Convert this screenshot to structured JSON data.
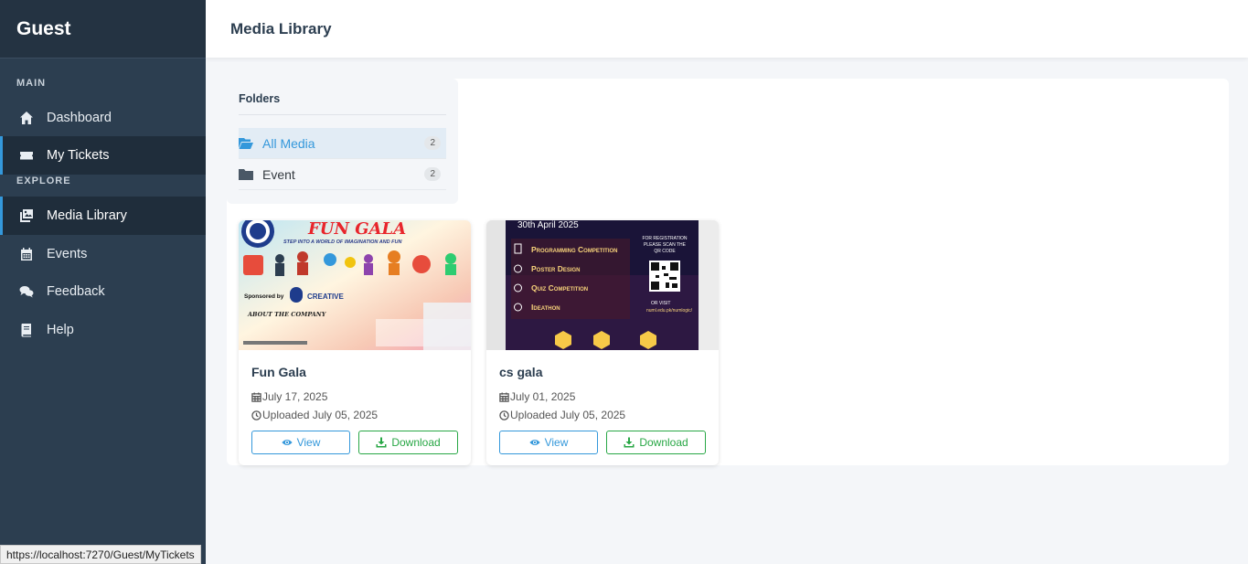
{
  "sidebar": {
    "brand": "Guest",
    "sections": {
      "main": "MAIN",
      "explore": "EXPLORE"
    },
    "items": [
      {
        "label": "Dashboard",
        "icon": "home-icon"
      },
      {
        "label": "My Tickets",
        "icon": "ticket-icon",
        "active": true
      },
      {
        "label": "Media Library",
        "icon": "photo-library-icon",
        "active": true
      },
      {
        "label": "Events",
        "icon": "calendar-icon"
      },
      {
        "label": "Feedback",
        "icon": "comments-icon"
      },
      {
        "label": "Help",
        "icon": "book-icon"
      }
    ]
  },
  "header": {
    "title": "Media Library"
  },
  "folders": {
    "title": "Folders",
    "items": [
      {
        "name": "All Media",
        "count": "2",
        "icon": "folder-open-icon",
        "active": true
      },
      {
        "name": "Event",
        "count": "2",
        "icon": "folder-icon"
      }
    ]
  },
  "media": [
    {
      "title": "Fun Gala",
      "date": "July 17, 2025",
      "uploaded": "Uploaded July 05, 2025",
      "view_label": "View",
      "download_label": "Download",
      "thumb_heading": "FUN GALA",
      "thumb_tagline": "STEP INTO A WORLD OF IMAGINATION AND FUN",
      "thumb_sponsor": "Sponsored by",
      "thumb_sponsor_name": "CREATIVE",
      "thumb_about": "ABOUT THE COMPANY"
    },
    {
      "title": "cs gala",
      "date": "July 01, 2025",
      "uploaded": "Uploaded July 05, 2025",
      "view_label": "View",
      "download_label": "Download",
      "thumb_date": "30th April 2025",
      "thumb_items": [
        "Programming Competition",
        "Poster Design",
        "Quiz Competition",
        "Ideathon"
      ],
      "thumb_reg": "FOR REGISTRATION PLEASE SCAN THE QR CODE",
      "thumb_visit": "OR VISIT",
      "thumb_url": "numl.edu.pk/numlogic/"
    }
  ],
  "statusbar": {
    "url": "https://localhost:7270/Guest/MyTickets"
  },
  "colors": {
    "sidebar": "#2c3e50",
    "accent": "#3498db",
    "success": "#28a745"
  }
}
